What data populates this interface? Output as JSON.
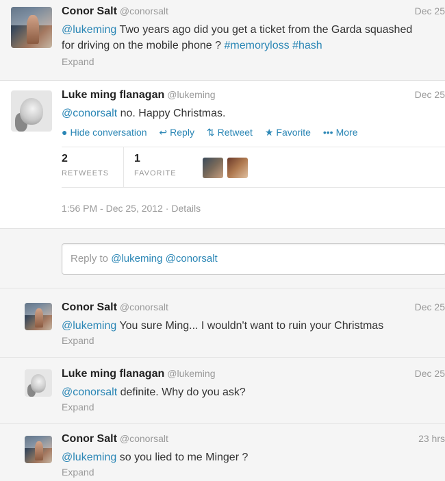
{
  "tweet1": {
    "name": "Conor Salt",
    "handle": "@conorsalt",
    "time": "Dec 25",
    "mention": "@lukeming",
    "text": " Two years ago did you get a ticket from the Garda squashed for driving on the mobile phone ? ",
    "hashtag1": "#memoryloss",
    "hashtag2": "#hash",
    "expand": "Expand"
  },
  "tweet2": {
    "name": "Luke ming flanagan",
    "handle": "@lukeming",
    "time": "Dec 25",
    "mention": "@conorsalt",
    "text": " no. Happy Christmas.",
    "actions": {
      "hide": "Hide conversation",
      "reply": "Reply",
      "retweet": "Retweet",
      "favorite": "Favorite",
      "more": "More"
    },
    "retweets_count": "2",
    "retweets_label": "RETWEETS",
    "favorites_count": "1",
    "favorites_label": "FAVORITE",
    "timestamp": "1:56 PM - Dec 25, 2012",
    "details": "Details"
  },
  "reply_box": {
    "prefix": "Reply to ",
    "mentions": "@lukeming @conorsalt"
  },
  "reply1": {
    "name": "Conor Salt",
    "handle": "@conorsalt",
    "time": "Dec 25",
    "mention": "@lukeming",
    "text": " You sure Ming... I wouldn't want to ruin your Christmas",
    "expand": "Expand"
  },
  "reply2": {
    "name": "Luke ming flanagan",
    "handle": "@lukeming",
    "time": "Dec 25",
    "mention": "@conorsalt",
    "text": " definite. Why do you ask?",
    "expand": "Expand"
  },
  "reply3": {
    "name": "Conor Salt",
    "handle": "@conorsalt",
    "time": "23 hrs",
    "mention": "@lukeming",
    "text": " so you lied to me Minger ?",
    "expand": "Expand"
  },
  "icons": {
    "hide": "speech-bubble-icon",
    "reply": "reply-arrow-icon",
    "retweet": "retweet-icon",
    "favorite": "star-icon",
    "more": "ellipsis-icon"
  },
  "colors": {
    "link": "#2a86b5",
    "background": "#f5f5f5",
    "card": "#ffffff",
    "muted": "#999999"
  }
}
